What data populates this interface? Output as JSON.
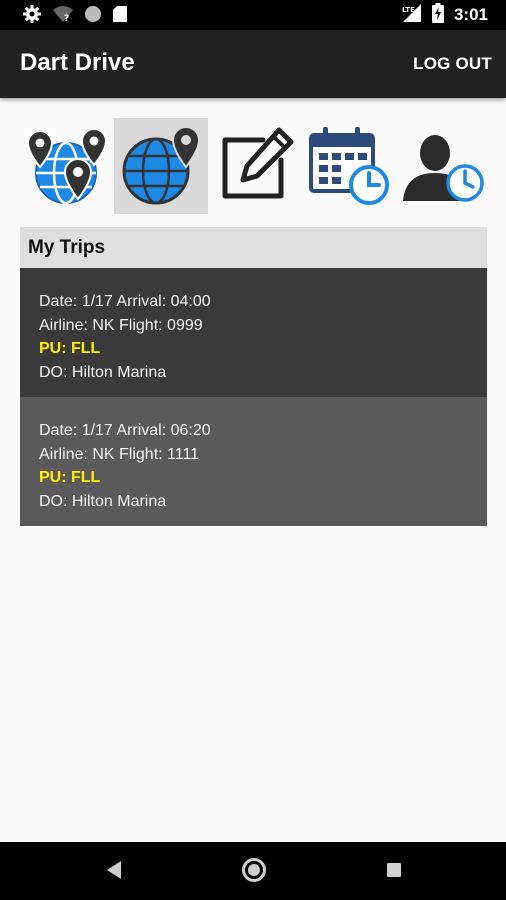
{
  "status_bar": {
    "time": "3:01",
    "network": "LTE",
    "icons_left": [
      "settings-icon",
      "wifi-question-icon",
      "circle-icon",
      "sd-card-icon"
    ],
    "icons_right": [
      "signal-icon",
      "battery-charging-icon"
    ]
  },
  "app_bar": {
    "title": "Dart Drive",
    "logout_label": "LOG OUT"
  },
  "nav_icons": [
    {
      "name": "map-pins-globe-icon",
      "selected": false
    },
    {
      "name": "globe-pin-icon",
      "selected": true
    },
    {
      "name": "edit-icon",
      "selected": false
    },
    {
      "name": "calendar-clock-icon",
      "selected": false
    },
    {
      "name": "user-clock-icon",
      "selected": false
    }
  ],
  "trips": {
    "header": "My Trips",
    "items": [
      {
        "date_line": "Date: 1/17 Arrival: 04:00",
        "airline_line": "Airline: NK Flight: 0999",
        "pu_line": "PU: FLL",
        "do_line": "DO: Hilton Marina"
      },
      {
        "date_line": "Date: 1/17 Arrival: 06:20",
        "airline_line": "Airline: NK Flight: 1111",
        "pu_line": "PU: FLL",
        "do_line": "DO: Hilton Marina"
      }
    ]
  },
  "colors": {
    "app_bar": "#212121",
    "accent_blue": "#1e88e5",
    "pickup_yellow": "#ffee00",
    "trip_dark": "#3a3a3a",
    "trip_light": "#5a5a5a"
  }
}
